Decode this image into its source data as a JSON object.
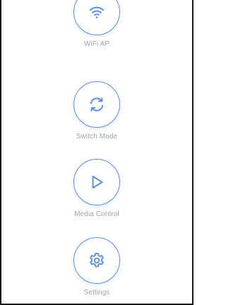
{
  "menu": {
    "items": [
      {
        "label": "WiFi AP",
        "icon": "wifi-icon"
      },
      {
        "label": "Switch Mode",
        "icon": "refresh-icon"
      },
      {
        "label": "Media Control",
        "icon": "play-icon"
      },
      {
        "label": "Settings",
        "icon": "gear-icon"
      }
    ]
  },
  "colors": {
    "accent": "#5b8def",
    "label": "#9aa3b0",
    "frame": "#1a1a1a"
  }
}
